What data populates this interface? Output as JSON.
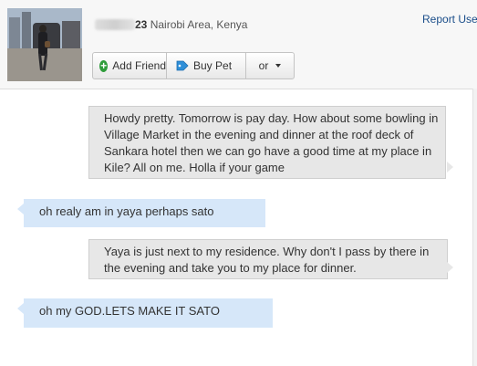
{
  "profile": {
    "name_number": "23",
    "location": "Nairobi Area, Kenya",
    "report_label": "Report Use"
  },
  "actions": {
    "add_friend": "Add Friend",
    "buy_pet": "Buy Pet",
    "more": "or"
  },
  "messages": [
    {
      "direction": "sent",
      "text": "Howdy pretty. Tomorrow is pay day. How about some bowling in Village Market in the evening and dinner at the roof deck of Sankara hotel then we can go have a good time at my place in Kile? All on me. Holla if your game"
    },
    {
      "direction": "received",
      "text": "oh realy am in yaya perhaps sato"
    },
    {
      "direction": "sent",
      "text": "Yaya is just next to my residence. Why don't I pass by there in the evening and take you to my place for dinner."
    },
    {
      "direction": "received",
      "text": "oh my GOD.LETS MAKE IT SATO"
    }
  ],
  "colors": {
    "sent_bubble": "#e7e7e7",
    "received_bubble": "#d6e7f9",
    "link": "#1b4e8a",
    "add_icon": "#2e9c3a",
    "tag_icon": "#2f8fd8"
  },
  "icons": {
    "add_friend": "plus-circle-icon",
    "buy_pet": "price-tag-icon",
    "more": "caret-down-icon"
  }
}
